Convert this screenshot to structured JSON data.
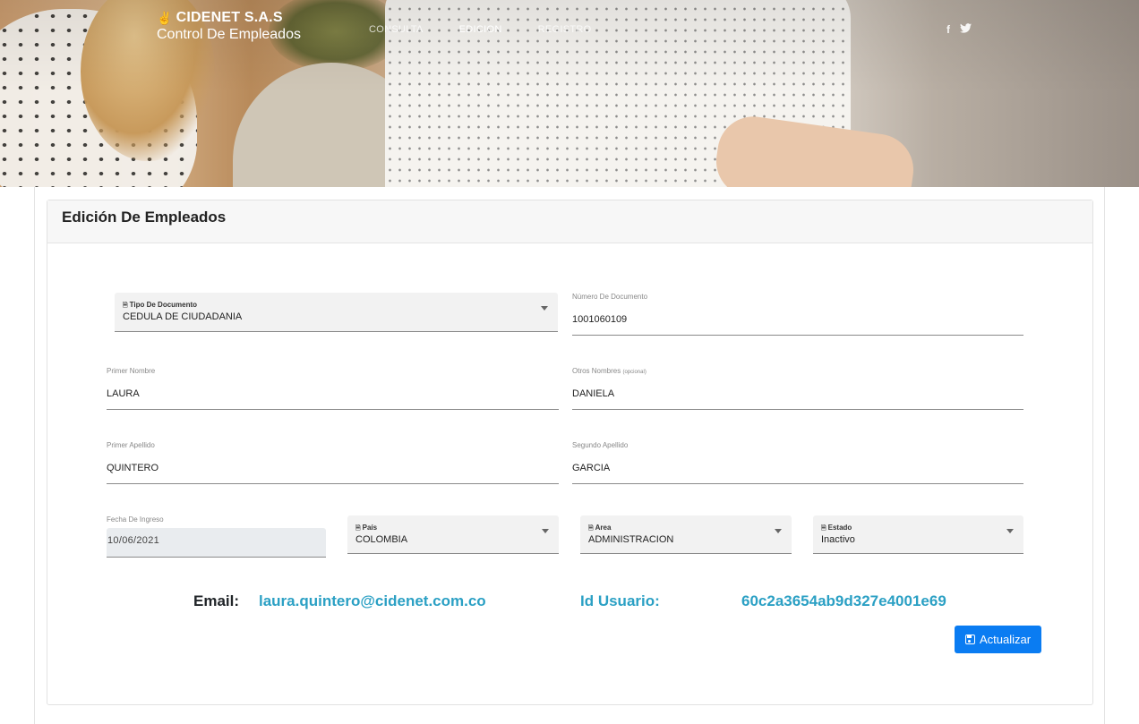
{
  "header": {
    "brand_name": "CIDENET S.A.S",
    "brand_subtitle": "Control De Empleados",
    "nav": [
      {
        "label": "CONSULTA",
        "active": false
      },
      {
        "label": "EDICION",
        "active": true
      },
      {
        "label": "REGISTRO",
        "active": false
      }
    ],
    "social": {
      "facebook": "f",
      "twitter": "🐦"
    }
  },
  "card": {
    "title": "Edición De Empleados"
  },
  "form": {
    "tipo_documento": {
      "label": "Tipo De Documento",
      "value": "CEDULA DE CIUDADANIA"
    },
    "numero_documento": {
      "label": "Número De Documento",
      "value": "1001060109"
    },
    "primer_nombre": {
      "label": "Primer Nombre",
      "value": "LAURA"
    },
    "otros_nombres": {
      "label": "Otros Nombres",
      "hint": "(opcional)",
      "value": "DANIELA"
    },
    "primer_apellido": {
      "label": "Primer Apellido",
      "value": "QUINTERO"
    },
    "segundo_apellido": {
      "label": "Segundo Apellido",
      "value": "GARCIA"
    },
    "fecha_ingreso": {
      "label": "Fecha De Ingreso",
      "value": "10/06/2021"
    },
    "pais": {
      "label": "País",
      "value": "COLOMBIA"
    },
    "area": {
      "label": "Area",
      "value": "ADMINISTRACION"
    },
    "estado": {
      "label": "Estado",
      "value": "Inactivo"
    }
  },
  "info": {
    "email_label": "Email:",
    "email_value": "laura.quintero@cidenet.com.co",
    "id_label": "Id Usuario:",
    "id_value": "60c2a3654ab9d327e4001e69"
  },
  "actions": {
    "update_label": "Actualizar"
  },
  "colors": {
    "accent_link": "#2ba0c4",
    "primary_button": "#0a7cf2"
  }
}
